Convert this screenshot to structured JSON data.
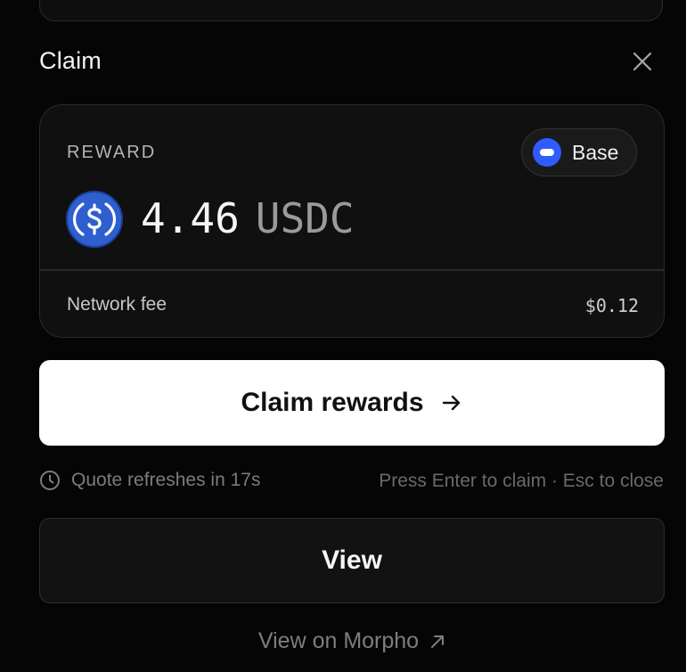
{
  "header": {
    "title": "Claim",
    "close_icon": "close-icon"
  },
  "reward_card": {
    "label": "REWARD",
    "network": {
      "name": "Base",
      "icon": "base-network-icon",
      "color": "#2f5bff"
    },
    "token_icon": "usdc-icon",
    "token_color": "#2f5fcf",
    "amount": "4.46",
    "unit": "USDC",
    "fee_label": "Network fee",
    "fee_value": "$0.12"
  },
  "claim_button": {
    "label": "Claim rewards",
    "icon": "arrow-right-icon"
  },
  "status": {
    "icon": "clock-icon",
    "refresh_text": "Quote refreshes in 17s",
    "hint": "Press Enter to claim · Esc to close"
  },
  "view_button": {
    "label": "View"
  },
  "morpho_link": {
    "label": "View on Morpho",
    "icon": "external-link-icon"
  }
}
